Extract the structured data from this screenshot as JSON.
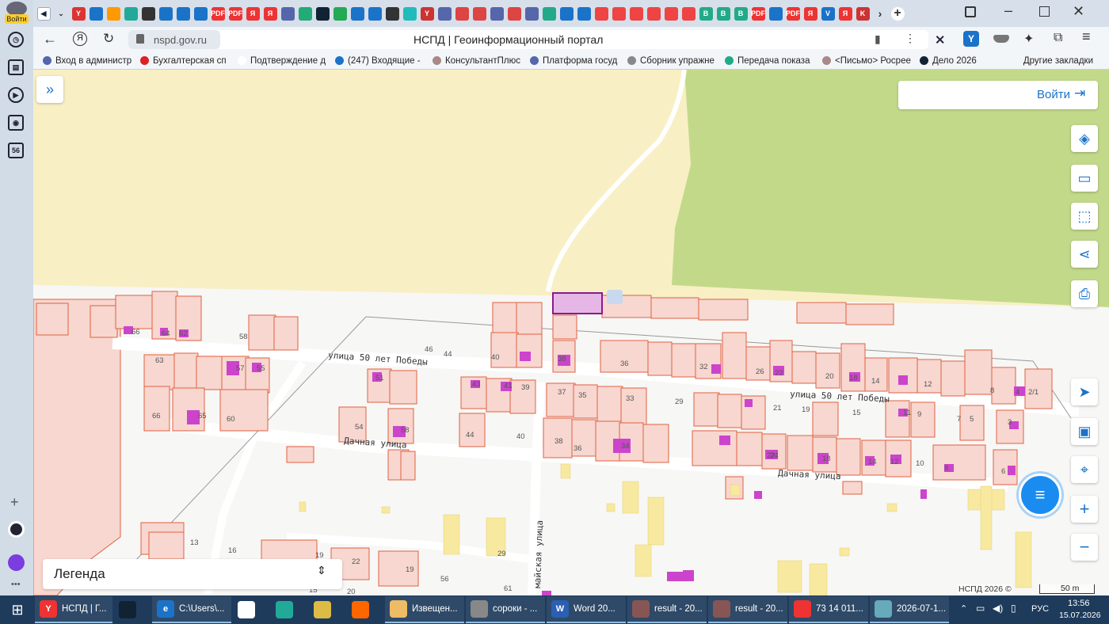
{
  "sidebar": {
    "user_label": "Войти",
    "badge": "56"
  },
  "tabs": {
    "icons": [
      {
        "color": "#d33",
        "text": "Y"
      },
      {
        "color": "#1a73c8",
        "text": ""
      },
      {
        "color": "#f90",
        "text": ""
      },
      {
        "color": "#2a9",
        "text": ""
      },
      {
        "color": "#333",
        "text": ""
      },
      {
        "color": "#1a73c8",
        "text": ""
      },
      {
        "color": "#1a73c8",
        "text": ""
      },
      {
        "color": "#1a73c8",
        "text": ""
      },
      {
        "color": "#e33",
        "text": "PDF"
      },
      {
        "color": "#e33",
        "text": "PDF"
      },
      {
        "color": "#e33",
        "text": "Я"
      },
      {
        "color": "#e33",
        "text": "Я"
      },
      {
        "color": "#56a",
        "text": ""
      },
      {
        "color": "#2a7",
        "text": ""
      },
      {
        "color": "#123",
        "text": ""
      },
      {
        "color": "#2a5",
        "text": ""
      },
      {
        "color": "#1a73c8",
        "text": ""
      },
      {
        "color": "#1a73c8",
        "text": ""
      },
      {
        "color": "#333",
        "text": ""
      },
      {
        "color": "#2bb",
        "text": ""
      },
      {
        "color": "#c33",
        "text": "Y"
      },
      {
        "color": "#56a",
        "text": ""
      },
      {
        "color": "#d44",
        "text": ""
      },
      {
        "color": "#d44",
        "text": ""
      },
      {
        "color": "#56a",
        "text": ""
      },
      {
        "color": "#d44",
        "text": ""
      },
      {
        "color": "#56a",
        "text": ""
      },
      {
        "color": "#2a8",
        "text": ""
      },
      {
        "color": "#1a73c8",
        "text": ""
      },
      {
        "color": "#1a73c8",
        "text": ""
      },
      {
        "color": "#e44",
        "text": ""
      },
      {
        "color": "#e44",
        "text": ""
      },
      {
        "color": "#e44",
        "text": ""
      },
      {
        "color": "#e44",
        "text": ""
      },
      {
        "color": "#e44",
        "text": ""
      },
      {
        "color": "#e44",
        "text": ""
      },
      {
        "color": "#2a8",
        "text": "B"
      },
      {
        "color": "#2a8",
        "text": "B"
      },
      {
        "color": "#2a8",
        "text": "B"
      },
      {
        "color": "#e33",
        "text": "PDF"
      },
      {
        "color": "#1a73c8",
        "text": ""
      },
      {
        "color": "#e33",
        "text": "PDF"
      },
      {
        "color": "#e33",
        "text": "Я"
      },
      {
        "color": "#1a73c8",
        "text": "V"
      },
      {
        "color": "#e33",
        "text": "Я"
      },
      {
        "color": "#c33",
        "text": "K"
      }
    ]
  },
  "address": {
    "url": "nspd.gov.ru",
    "title": "НСПД | Геоинформационный портал"
  },
  "bookmarks": [
    {
      "label": "Вход в администр",
      "color": "#56a"
    },
    {
      "label": "Бухгалтерская сп",
      "color": "#d22"
    },
    {
      "label": "Подтверждение д",
      "color": "#fff"
    },
    {
      "label": "(247) Входящие -",
      "color": "#1a73c8"
    },
    {
      "label": "КонсультантПлюс",
      "color": "#a88"
    },
    {
      "label": "Платформа госуд",
      "color": "#56a"
    },
    {
      "label": "Сборник упражне",
      "color": "#888"
    },
    {
      "label": "Передача показа",
      "color": "#2a8"
    },
    {
      "label": "<Письмо> Росрее",
      "color": "#a88"
    },
    {
      "label": "Дело 2026",
      "color": "#123"
    }
  ],
  "bookmarks_more": "Другие закладки",
  "map": {
    "login_label": "Войти",
    "legend_label": "Легенда",
    "attribution": "НСПД 2026 ©",
    "scale": "50 m",
    "streets": [
      {
        "text": "улица 50 лет Победы"
      },
      {
        "text": "улица 50 лет Победы"
      },
      {
        "text": "Дачная улица"
      },
      {
        "text": "Дачная улица"
      },
      {
        "text": "майская улица"
      }
    ],
    "house_numbers": [
      "66",
      "64",
      "62",
      "58",
      "46",
      "44",
      "40",
      "38",
      "36",
      "32",
      "26",
      "22",
      "20",
      "18",
      "14",
      "12",
      "8",
      "4",
      "2/1",
      "63",
      "57",
      "55",
      "51",
      "43",
      "41",
      "39",
      "37",
      "35",
      "33",
      "29",
      "21",
      "19",
      "15",
      "11",
      "9",
      "7",
      "5",
      "3",
      "66",
      "65",
      "60",
      "54",
      "58",
      "44",
      "40",
      "38",
      "36",
      "34",
      "24",
      "22",
      "18",
      "14",
      "12",
      "10",
      "8",
      "6",
      "13",
      "16",
      "19",
      "22",
      "19",
      "20",
      "56",
      "61",
      "29",
      "15"
    ],
    "colors": {
      "parcel_stroke": "#e06040",
      "parcel_fill": "#f7d7d0",
      "building": "#cc44cc",
      "field": "#f8f0c4",
      "forest": "#c3d98a",
      "selected": "#8a1a8a"
    }
  },
  "taskbar": {
    "items": [
      {
        "label": "НСПД | Г...",
        "color": "#e33",
        "icon": "Y",
        "open": true
      },
      {
        "label": "",
        "color": "#123",
        "icon": "",
        "open": false
      },
      {
        "label": "C:\\Users\\...",
        "color": "#1a73c8",
        "icon": "e",
        "open": true
      },
      {
        "label": "",
        "color": "#fff",
        "icon": "",
        "open": false
      },
      {
        "label": "",
        "color": "#2a9",
        "icon": "",
        "open": false
      },
      {
        "label": "",
        "color": "#db4",
        "icon": "",
        "open": false
      },
      {
        "label": "",
        "color": "#f60",
        "icon": "",
        "open": false
      },
      {
        "label": "Извещен...",
        "color": "#eb6",
        "icon": "",
        "open": true
      },
      {
        "label": "сороки - ...",
        "color": "#888",
        "icon": "",
        "open": true
      },
      {
        "label": "Word 20...",
        "color": "#2b5fb3",
        "icon": "W",
        "open": true
      },
      {
        "label": "result - 20...",
        "color": "#855",
        "icon": "",
        "open": true
      },
      {
        "label": "result - 20...",
        "color": "#855",
        "icon": "",
        "open": true
      },
      {
        "label": "73 14 011...",
        "color": "#e33",
        "icon": "",
        "open": true
      },
      {
        "label": "2026-07-1...",
        "color": "#6ab",
        "icon": "",
        "open": true
      }
    ],
    "lang": "РУС",
    "time": "13:56",
    "date": "15.07.2026"
  }
}
